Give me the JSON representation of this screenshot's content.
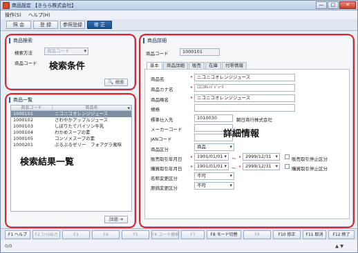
{
  "window": {
    "title": "商品設定 【きらら株式会社】",
    "controls": [
      "—",
      "□",
      "✕"
    ]
  },
  "menu": [
    "操作(S)",
    "ヘルプ(H)"
  ],
  "toolbar": [
    "照 会",
    "登 録",
    "参照登録",
    "修 正"
  ],
  "search_panel": {
    "title": "商品検索",
    "method_label": "検索方法",
    "method_value": "商品コード",
    "code_label": "商品コード",
    "search_button": "検索",
    "overlay": "検索条件"
  },
  "list_panel": {
    "title": "商品一覧",
    "columns": [
      "商品コード",
      "商品名"
    ],
    "rows": [
      [
        "1000101",
        "ニコニコオレンジジュース"
      ],
      [
        "1000102",
        "さわやかアップルジュース"
      ],
      [
        "1000103",
        "しぼりたてパイソン牛乳"
      ],
      [
        "1000104",
        "わかめスープの素"
      ],
      [
        "1000105",
        "コンソメスープの素"
      ],
      [
        "1000201",
        "ぷるぷるゼリー　フォアグラ風味"
      ]
    ],
    "detail_button": "詳細",
    "overlay": "検索結果一覧"
  },
  "detail_panel": {
    "title": "商品詳細",
    "code_label": "商品コード",
    "code_value": "1000101",
    "tabs": [
      "基本",
      "商品詳細",
      "販売",
      "在庫",
      "付帯情報"
    ],
    "overlay": "詳細情報",
    "fields": {
      "name_label": "商品名",
      "name_value": "ニコニコオレンジジュース",
      "kana_label": "商品カナ名",
      "kana_value": "ﾆｺﾆｺｵﾚﾝｼﾞｼﾞｭｰｽ",
      "short_label": "商品略名",
      "short_value": "ニコニコオレンジジュース",
      "spec_label": "規格",
      "supplier_label": "標準仕入先",
      "supplier_code": "1010030",
      "supplier_name": "朝日商行株式会社",
      "maker_label": "メーカーコード",
      "jan_label": "JANコード",
      "category_label": "商品区分",
      "category_value": "商品",
      "sale_period_label": "販売取引年月日",
      "sale_from": "1901/01/01",
      "sale_to": "2999/12/31",
      "sale_stop_label": "販売取引停止区分",
      "purchase_period_label": "購買取引年月日",
      "purchase_from": "1901/01/01",
      "purchase_to": "2999/12/31",
      "purchase_stop_label": "購買取引停止区分",
      "name_change_label": "名称変更区分",
      "name_change_value": "不可",
      "cost_change_label": "原価変更区分",
      "cost_change_value": "不可",
      "tilde": "～"
    }
  },
  "fkeys": [
    "F1 ヘルプ",
    "F2 ﾌｧｲﾙ出力",
    "F3",
    "F4",
    "F5",
    "F6 コード検索",
    "F7",
    "F8 モード切替",
    "F9",
    "F10 修正",
    "F11 取消",
    "F12 終了"
  ],
  "status": {
    "left": "0/0",
    "arrows": "▲ ▼"
  }
}
